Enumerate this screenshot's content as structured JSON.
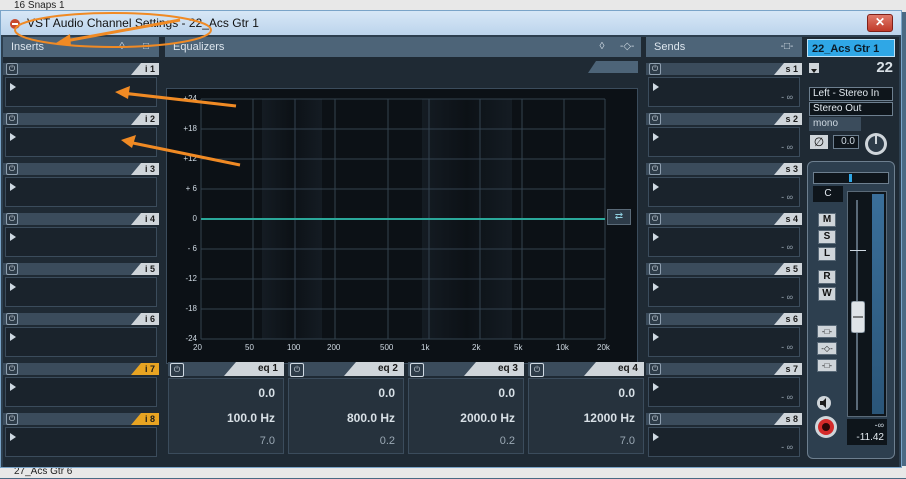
{
  "background_rows": {
    "top": "16  Snaps 1",
    "bottom": "27_Acs Gtr 6"
  },
  "window": {
    "title": "VST Audio Channel Settings - 22_Acs Gtr 1",
    "close_label": "✕"
  },
  "inserts": {
    "header": "Inserts",
    "slots": [
      {
        "label": "i 1",
        "highlight": false
      },
      {
        "label": "i 2",
        "highlight": false
      },
      {
        "label": "i 3",
        "highlight": false
      },
      {
        "label": "i 4",
        "highlight": false
      },
      {
        "label": "i 5",
        "highlight": false
      },
      {
        "label": "i 6",
        "highlight": false
      },
      {
        "label": "i 7",
        "highlight": true
      },
      {
        "label": "i 8",
        "highlight": true
      }
    ]
  },
  "equalizers": {
    "header": "Equalizers",
    "y_labels": [
      "+24",
      "+18",
      "+12",
      "+ 6",
      "0",
      "- 6",
      "-12",
      "-18",
      "-24"
    ],
    "x_labels": [
      "20",
      "50",
      "100",
      "200",
      "500",
      "1k",
      "2k",
      "5k",
      "10k",
      "20k"
    ],
    "bands": [
      {
        "label": "eq 1",
        "gain": "0.0",
        "freq": "100.0 Hz",
        "q": "7.0"
      },
      {
        "label": "eq 2",
        "gain": "0.0",
        "freq": "800.0 Hz",
        "q": "0.2"
      },
      {
        "label": "eq 3",
        "gain": "0.0",
        "freq": "2000.0 Hz",
        "q": "0.2"
      },
      {
        "label": "eq 4",
        "gain": "0.0",
        "freq": "12000 Hz",
        "q": "7.0"
      }
    ]
  },
  "sends": {
    "header": "Sends",
    "slots": [
      {
        "label": "s 1",
        "value": "- ∞"
      },
      {
        "label": "s 2",
        "value": "- ∞"
      },
      {
        "label": "s 3",
        "value": "- ∞"
      },
      {
        "label": "s 4",
        "value": "- ∞"
      },
      {
        "label": "s 5",
        "value": "- ∞"
      },
      {
        "label": "s 6",
        "value": "- ∞"
      },
      {
        "label": "s 7",
        "value": "- ∞"
      },
      {
        "label": "s 8",
        "value": "- ∞"
      }
    ]
  },
  "channel": {
    "name": "22_Acs Gtr 1",
    "number": "22",
    "input_routing": "Left - Stereo In",
    "output_routing": "Stereo Out",
    "mono_label": "mono",
    "phase_value": "0.0",
    "pan_label": "C",
    "buttons": {
      "mute": "M",
      "solo": "S",
      "listen": "L",
      "read": "R",
      "write": "W"
    },
    "level_top": "-∞",
    "level_value": "-11.42"
  },
  "colors": {
    "accent": "#2fa7e6",
    "insert_highlight": "#e8a422",
    "eq_curve": "#2aa89a",
    "annotation": "#f08a24"
  }
}
